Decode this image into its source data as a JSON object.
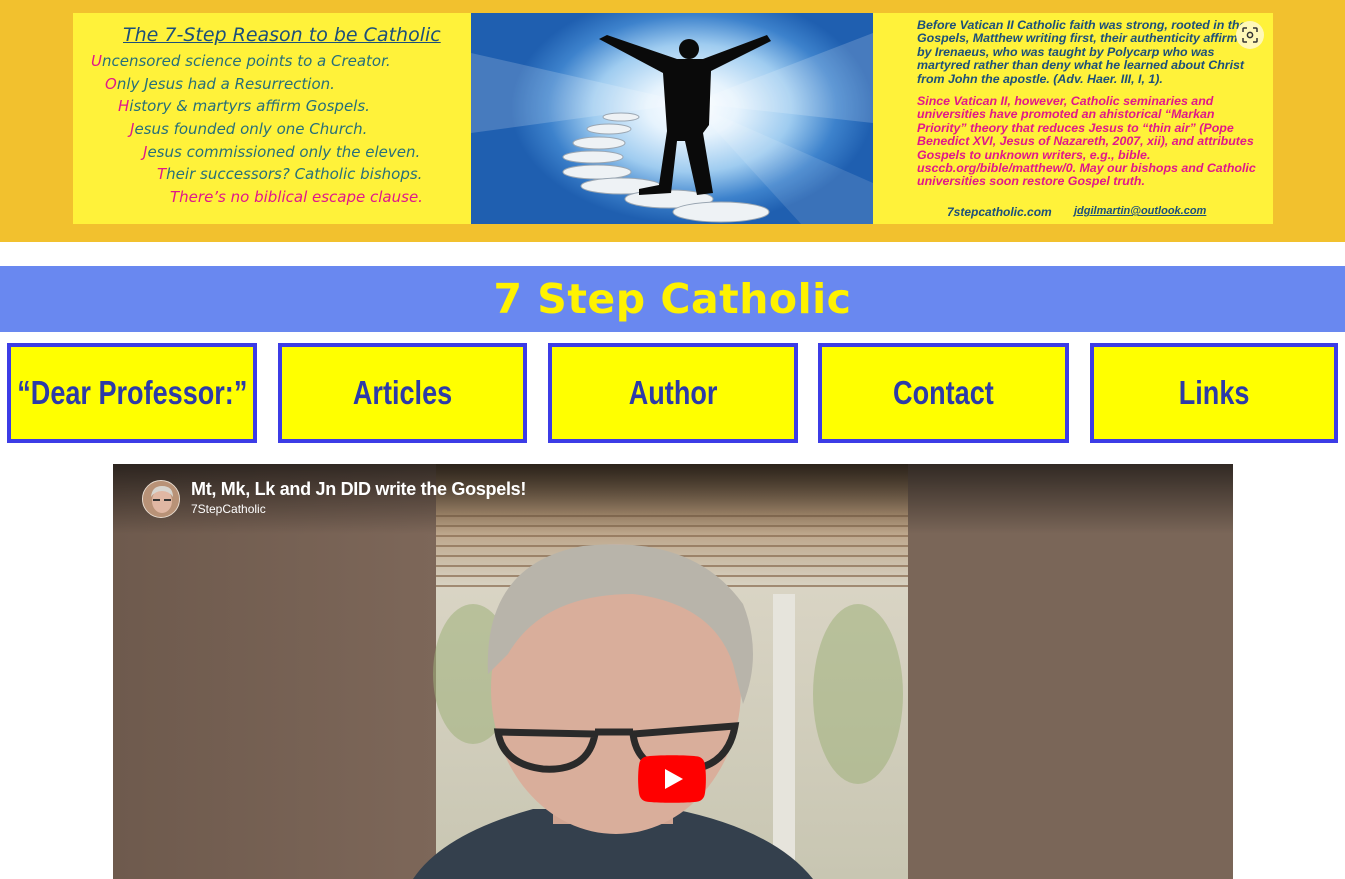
{
  "banner": {
    "title": "The 7-Step Reason to be Catholic",
    "steps": [
      {
        "initial": "U",
        "rest": "ncensored science points to a Creator."
      },
      {
        "initial": "O",
        "rest": "nly Jesus had a Resurrection."
      },
      {
        "initial": "H",
        "rest": "istory & martyrs affirm Gospels."
      },
      {
        "initial": "J",
        "rest": "esus founded only one Church."
      },
      {
        "initial": "J",
        "rest": "esus commissioned only the eleven."
      },
      {
        "initial": "T",
        "rest": "heir successors? Catholic bishops."
      }
    ],
    "closing": "There’s no biblical escape clause.",
    "paragraph1": "Before Vatican II Catholic faith was strong, rooted in the Gospels, Matthew writing first, their authenticity affirmed by Irenaeus, who was taught by Polycarp who was martyred rather than deny what he learned about Christ from John the apostle. (Adv. Haer. III, I, 1).",
    "paragraph2": "Since Vatican II, however, Catholic seminaries and universities have promoted an ahistorical “Markan Priority” theory that reduces Jesus to “thin air” (Pope Benedict XVI, Jesus of Nazareth, 2007, xii), and attributes Gospels to unknown writers, e.g., bible. usccb.org/bible/matthew/0. May our bishops and Catholic universities soon restore Gospel truth.",
    "site_url": "7stepcatholic.com",
    "email": "jdgilmartin@outlook.com",
    "lens_icon": "lens-search-icon"
  },
  "site_title": "7 Step Catholic",
  "nav": [
    {
      "label": "“Dear Professor:”"
    },
    {
      "label": "Articles"
    },
    {
      "label": "Author"
    },
    {
      "label": "Contact"
    },
    {
      "label": "Links"
    }
  ],
  "video": {
    "title": "Mt, Mk, Lk and Jn DID write the Gospels!",
    "channel": "7StepCatholic",
    "play_icon": "youtube-play-icon"
  },
  "colors": {
    "banner_strip": "#f2c12e",
    "banner_panel": "#fff23a",
    "title_bar": "#6988f0",
    "title_text": "#fff200",
    "nav_fill": "#ffff00",
    "nav_border": "#3c3ce6",
    "nav_text": "#2d3ba8",
    "magenta": "#e0188a",
    "teal": "#276f7a",
    "play_red": "#ff0000"
  }
}
